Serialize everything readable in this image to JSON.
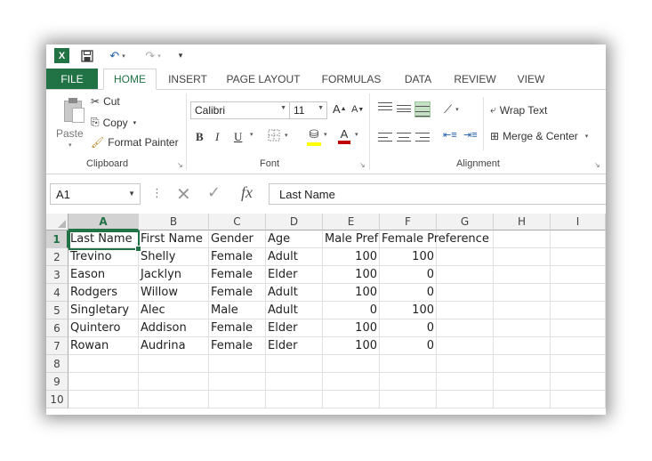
{
  "app": {
    "logo_letter": "X",
    "quick_access": {
      "save_icon": "save-icon",
      "undo_icon": "undo-icon",
      "redo_icon": "redo-icon"
    }
  },
  "tabs": [
    {
      "label": "FILE"
    },
    {
      "label": "HOME",
      "active": true
    },
    {
      "label": "INSERT"
    },
    {
      "label": "PAGE LAYOUT"
    },
    {
      "label": "FORMULAS"
    },
    {
      "label": "DATA"
    },
    {
      "label": "REVIEW"
    },
    {
      "label": "VIEW"
    }
  ],
  "ribbon": {
    "clipboard": {
      "paste_label": "Paste",
      "cut_label": "Cut",
      "copy_label": "Copy",
      "format_painter_label": "Format Painter",
      "group_label": "Clipboard"
    },
    "font": {
      "font_name": "Calibri",
      "font_size": "11",
      "bold": "B",
      "italic": "I",
      "underline": "U",
      "group_label": "Font",
      "accent_colors": {
        "fill": "#ffff00",
        "font": "#c00000"
      }
    },
    "alignment": {
      "wrap_text_label": "Wrap Text",
      "merge_center_label": "Merge & Center",
      "group_label": "Alignment"
    }
  },
  "formula_bar": {
    "name_box": "A1",
    "fx": "fx",
    "content": "Last Name"
  },
  "sheet": {
    "columns": [
      "A",
      "B",
      "C",
      "D",
      "E",
      "F",
      "G",
      "H",
      "I"
    ],
    "selected_column": "A",
    "selected_row": 1,
    "row_numbers": [
      1,
      2,
      3,
      4,
      5,
      6,
      7,
      8,
      9,
      10
    ],
    "header_row": [
      "Last Name",
      "First Name",
      "Gender",
      "Age",
      "Male Pref",
      "Female Preference"
    ],
    "rows": [
      [
        "Trevino",
        "Shelly",
        "Female",
        "Adult",
        "100",
        "100"
      ],
      [
        "Eason",
        "Jacklyn",
        "Female",
        "Elder",
        "100",
        "0"
      ],
      [
        "Rodgers",
        "Willow",
        "Female",
        "Adult",
        "100",
        "0"
      ],
      [
        "Singletary",
        "Alec",
        "Male",
        "Adult",
        "0",
        "100"
      ],
      [
        "Quintero",
        "Addison",
        "Female",
        "Elder",
        "100",
        "0"
      ],
      [
        "Rowan",
        "Audrina",
        "Female",
        "Elder",
        "100",
        "0"
      ]
    ]
  },
  "colors": {
    "accent": "#217346"
  }
}
